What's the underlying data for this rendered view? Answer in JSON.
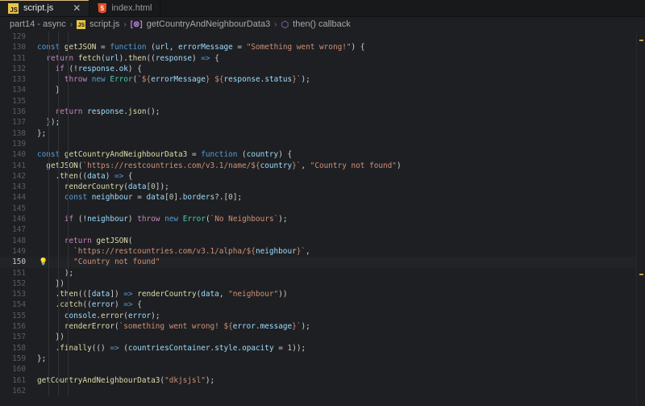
{
  "tabs": [
    {
      "label": "script.js",
      "icon": "js-file-icon",
      "active": true
    },
    {
      "label": "index.html",
      "icon": "html-file-icon",
      "active": false
    }
  ],
  "breadcrumb": {
    "folder": "part14 - async",
    "file": "script.js",
    "symbol": "getCountryAndNeighbourData3",
    "callback": "then() callback"
  },
  "editor": {
    "current_line": 150,
    "lines": [
      {
        "n": 129,
        "html": ""
      },
      {
        "n": 130,
        "html": "<span class='kb'>const</span> <span class='fn'>getJSON</span> = <span class='kb'>function</span> (<span class='vr'>url</span>, <span class='vr'>errorMessage</span> = <span class='st'>\"Something went wrong!\"</span>) {"
      },
      {
        "n": 131,
        "html": "  <span class='kw'>return</span> <span class='fn'>fetch</span>(<span class='vr'>url</span>).<span class='fn'>then</span>((<span class='vr'>response</span>) <span class='kb'>=&gt;</span> {"
      },
      {
        "n": 132,
        "html": "    <span class='kw'>if</span> (!<span class='vr'>response</span>.<span class='vr'>ok</span>) {"
      },
      {
        "n": 133,
        "html": "      <span class='kw'>throw</span> <span class='kb'>new</span> <span class='tc'>Error</span>(<span class='st'>`${</span><span class='vr'>errorMessage</span><span class='st'>} ${</span><span class='vr'>response</span>.<span class='vr'>status</span><span class='st'>}`</span>);"
      },
      {
        "n": 134,
        "html": "    }"
      },
      {
        "n": 135,
        "html": ""
      },
      {
        "n": 136,
        "html": "    <span class='kw'>return</span> <span class='vr'>response</span>.<span class='fn'>json</span>();"
      },
      {
        "n": 137,
        "html": "  });"
      },
      {
        "n": 138,
        "html": "};"
      },
      {
        "n": 139,
        "html": ""
      },
      {
        "n": 140,
        "html": "<span class='kb'>const</span> <span class='fn'>getCountryAndNeighbourData3</span> = <span class='kb'>function</span> (<span class='vr'>country</span>) {"
      },
      {
        "n": 141,
        "html": "  <span class='fn'>getJSON</span>(<span class='st'>`https://restcountries.com/v3.1/name/${</span><span class='vr'>country</span><span class='st'>}`</span>, <span class='st'>\"Country not found\"</span>)"
      },
      {
        "n": 142,
        "html": "    .<span class='fn'>then</span>((<span class='vr'>data</span>) <span class='kb'>=&gt;</span> {"
      },
      {
        "n": 143,
        "html": "      <span class='fn'>renderCountry</span>(<span class='vr'>data</span>[<span class='nm'>0</span>]);"
      },
      {
        "n": 144,
        "html": "      <span class='kb'>const</span> <span class='vr'>neighbour</span> = <span class='vr'>data</span>[<span class='nm'>0</span>].<span class='vr'>borders</span>?.[<span class='nm'>0</span>];"
      },
      {
        "n": 145,
        "html": ""
      },
      {
        "n": 146,
        "html": "      <span class='kw'>if</span> (!<span class='vr'>neighbour</span>) <span class='kw'>throw</span> <span class='kb'>new</span> <span class='tc'>Error</span>(<span class='st'>`No Neighbours`</span>);"
      },
      {
        "n": 147,
        "html": ""
      },
      {
        "n": 148,
        "html": "      <span class='kw'>return</span> <span class='fn'>getJSON</span>("
      },
      {
        "n": 149,
        "html": "        <span class='st'>`https://restcountries.com/v3.1/alpha/${</span><span class='vr'>neighbour</span><span class='st'>}`</span>,"
      },
      {
        "n": 150,
        "html": "        <span class='st'>\"Country not found\"</span>"
      },
      {
        "n": 151,
        "html": "      );"
      },
      {
        "n": 152,
        "html": "    })"
      },
      {
        "n": 153,
        "html": "    .<span class='fn'>then</span>(([<span class='vr'>data</span>]) <span class='kb'>=&gt;</span> <span class='fn'>renderCountry</span>(<span class='vr'>data</span>, <span class='st'>\"neighbour\"</span>))"
      },
      {
        "n": 154,
        "html": "    .<span class='fn'>catch</span>((<span class='vr'>error</span>) <span class='kb'>=&gt;</span> {"
      },
      {
        "n": 155,
        "html": "      <span class='vr'>console</span>.<span class='fn'>error</span>(<span class='vr'>error</span>);"
      },
      {
        "n": 156,
        "html": "      <span class='fn'>renderError</span>(<span class='st'>`something went wrong! ${</span><span class='vr'>error</span>.<span class='vr'>message</span><span class='st'>}`</span>);"
      },
      {
        "n": 157,
        "html": "    })"
      },
      {
        "n": 158,
        "html": "    .<span class='fn'>finally</span>(() <span class='kb'>=&gt;</span> (<span class='vr'>countriesContainer</span>.<span class='vr'>style</span>.<span class='vr'>opacity</span> = <span class='nm'>1</span>));"
      },
      {
        "n": 159,
        "html": "};"
      },
      {
        "n": 160,
        "html": ""
      },
      {
        "n": 161,
        "html": "<span class='fn'>getCountryAndNeighbourData3</span>(<span class='st'>\"dkjsjsl\"</span>);"
      },
      {
        "n": 162,
        "html": ""
      }
    ]
  },
  "colors": {
    "background": "#1e1f22",
    "keyword": "#c586c0",
    "storage": "#569cd6",
    "function": "#dcdcaa",
    "variable": "#9cdcfe",
    "string": "#ce9178",
    "number": "#b5cea8"
  }
}
